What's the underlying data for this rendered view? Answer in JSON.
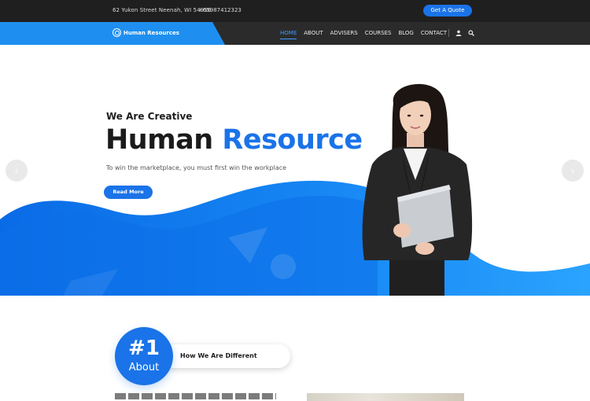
{
  "topbar": {
    "address": "62 Yukon Street Neenah, WI 54956",
    "phone": "+65987412323",
    "quote_button": "Get A Quote"
  },
  "nav": {
    "brand": "Human Resources",
    "items": [
      {
        "label": "HOME",
        "active": true
      },
      {
        "label": "ABOUT",
        "active": false
      },
      {
        "label": "ADVISERS",
        "active": false
      },
      {
        "label": "COURSES",
        "active": false
      },
      {
        "label": "BLOG",
        "active": false
      },
      {
        "label": "CONTACT",
        "active": false
      }
    ],
    "icons": [
      "user-icon",
      "search-icon"
    ]
  },
  "hero": {
    "tagline": "We Are Creative",
    "headline_dark": "Human",
    "headline_blue": "Resource",
    "subline": "To win the marketplace, you must first win the workplace",
    "button": "Read More",
    "prev_icon": "chevron-left-icon",
    "next_icon": "chevron-right-icon"
  },
  "about": {
    "number": "#1",
    "label": "About",
    "pill_text": "How We Are Different"
  },
  "colors": {
    "accent": "#1a73e8",
    "topbar": "#1f1f1f",
    "navbar": "#2b2b2b",
    "brand_bg": "#1e8ff0"
  }
}
